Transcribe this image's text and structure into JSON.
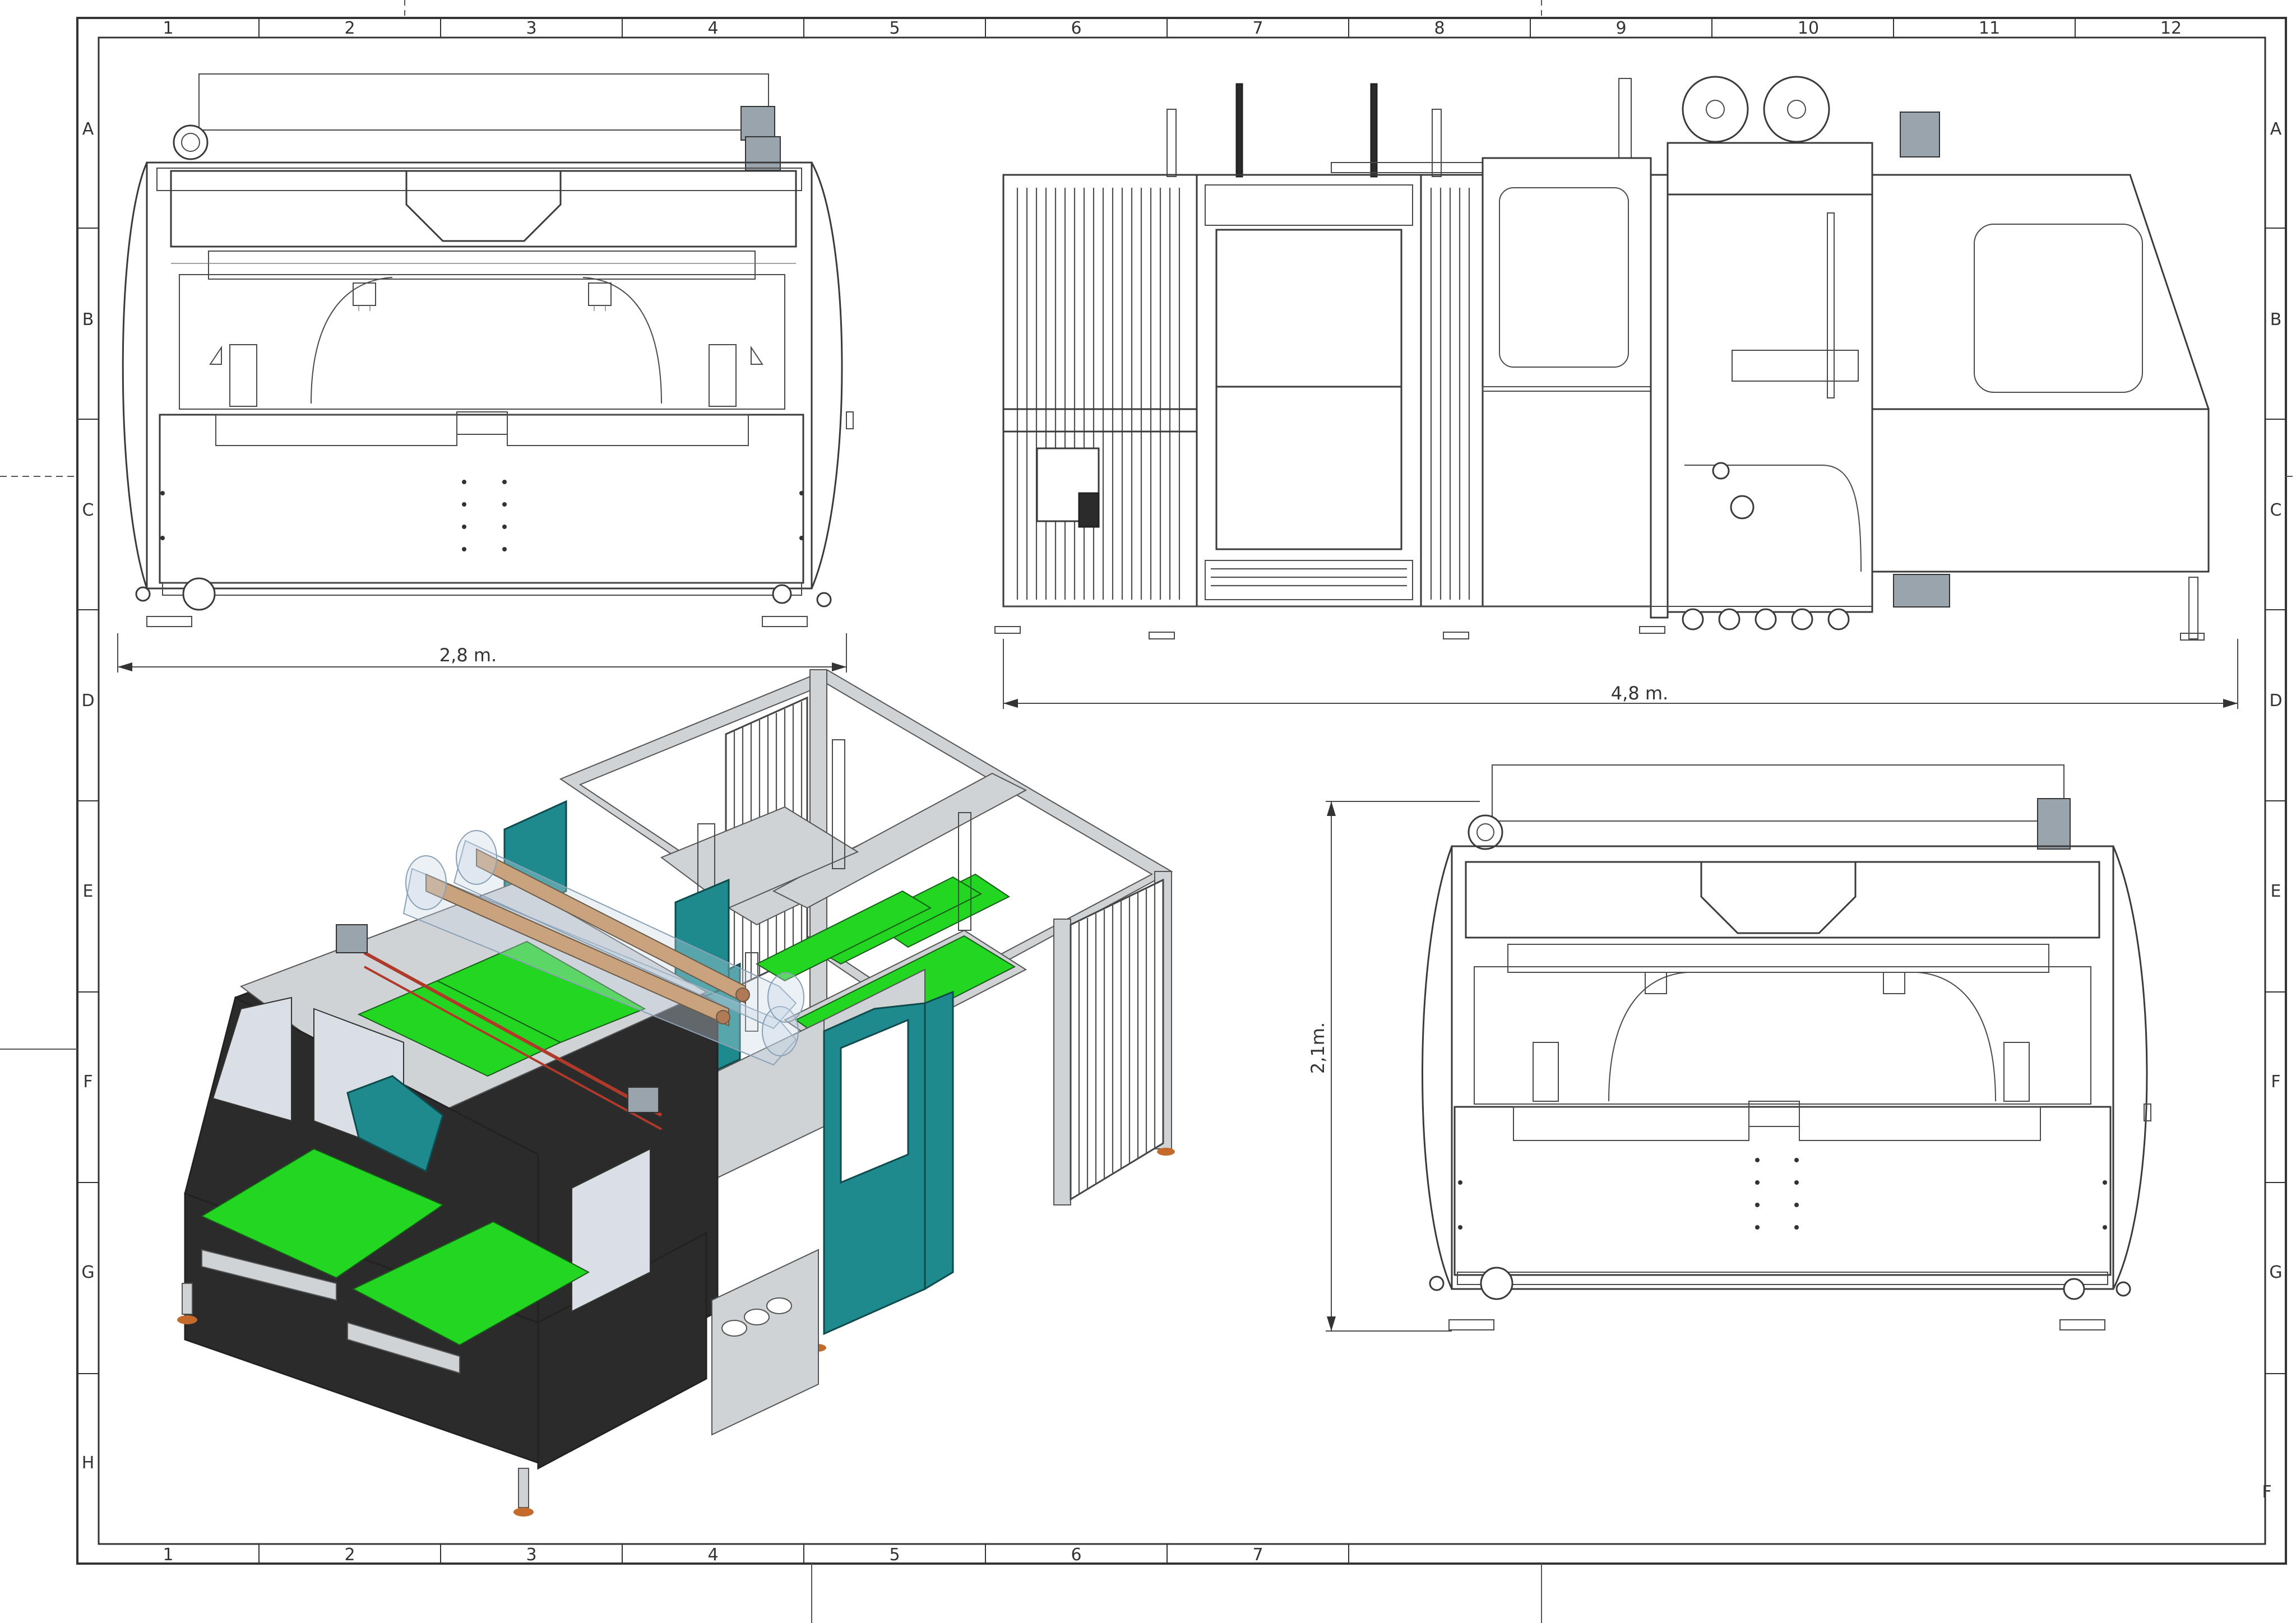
{
  "sheet": {
    "column_labels_top": [
      "1",
      "2",
      "3",
      "4",
      "5",
      "6",
      "7",
      "8",
      "9",
      "10",
      "11",
      "12"
    ],
    "column_labels_bottom": [
      "1",
      "2",
      "3",
      "4",
      "5",
      "6",
      "7"
    ],
    "row_labels_left": [
      "A",
      "B",
      "C",
      "D",
      "E",
      "F",
      "G",
      "H"
    ],
    "row_labels_right": [
      "A",
      "B",
      "C",
      "D",
      "E",
      "F",
      "G"
    ],
    "row_label_right_extra": "F"
  },
  "views": {
    "front": {
      "width_dimension": "2,8 m."
    },
    "side": {
      "length_dimension": "4,8 m."
    },
    "end": {
      "height_dimension": "2,1m."
    }
  },
  "colors": {
    "belt": "#22d622",
    "teal": "#1e8a8e",
    "frame_dark": "#2b2b2b",
    "line": "#3a3a3a"
  }
}
